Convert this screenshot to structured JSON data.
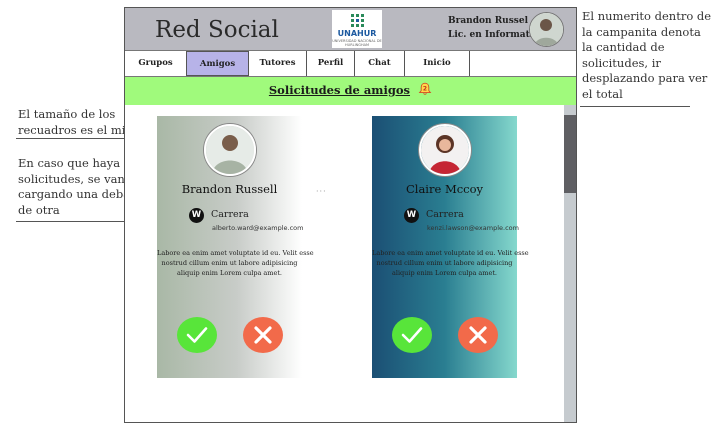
{
  "notes": {
    "card_size": "El tamaño de los\nrecuadros es el mismo",
    "loading": "En caso que haya mas\nsolicitudes, se van\ncargando una debajo\nde otra",
    "bell": "El numerito dentro de\nla campanita denota\nla cantidad de\nsolicitudes, ir\ndesplazando para ver\nel total"
  },
  "header": {
    "title": "Red Social",
    "logo_text": "UNAHUR",
    "logo_subtext": "UNIVERSIDAD NACIONAL DE HURLINGHAM",
    "user_name": "Brandon Russel",
    "user_degree": "Lic. en Informatica"
  },
  "nav": {
    "tabs": [
      {
        "label": "Grupos"
      },
      {
        "label": "Amigos"
      },
      {
        "label": "Tutores"
      },
      {
        "label": "Perfil"
      },
      {
        "label": "Chat"
      },
      {
        "label": "Inicio"
      }
    ],
    "active": "Amigos"
  },
  "banner": {
    "title": "Solicitudes de amigos",
    "badge_count": "2"
  },
  "requests": [
    {
      "name": "Brandon Russell",
      "career_icon": "W",
      "career": "Carrera",
      "email": "alberto.ward@example.com",
      "description": "Labore ea enim amet voluptate id eu. Velit esse\nnostrud cillum enim ut labore adipisicing\naliquip enim Lorem culpa amet."
    },
    {
      "name": "Claire Mccoy",
      "career_icon": "W",
      "career": "Carrera",
      "email": "kenzi.lawson@example.com",
      "description": "Labore ea enim amet voluptate id eu. Velit esse\nnostrud cillum enim ut labore adipisicing\naliquip enim Lorem culpa amet."
    }
  ],
  "colors": {
    "header_bg": "#b9b9c0",
    "active_tab": "#b7b3e8",
    "banner_bg": "#a0fa7c",
    "accept": "#58e53a",
    "reject": "#f26a4a"
  }
}
